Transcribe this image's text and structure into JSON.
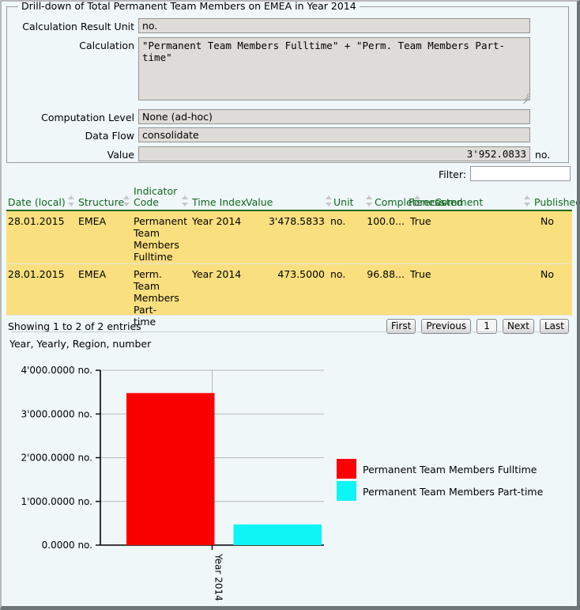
{
  "window": {
    "legend_title": "Drill-down of Total Permanent Team Members on EMEA in Year 2014"
  },
  "form": {
    "fields": [
      {
        "label": "Calculation Result Unit",
        "value": "no."
      },
      {
        "label": "Calculation",
        "value": "\"Permanent Team Members Fulltime\" + \"Perm. Team Members Part-time\""
      },
      {
        "label": "Computation Level",
        "value": "None (ad-hoc)"
      },
      {
        "label": "Data Flow",
        "value": "consolidate"
      },
      {
        "label": "Value",
        "value": "3'952.0833"
      }
    ],
    "value_unit": "no."
  },
  "filter": {
    "label": "Filter:",
    "value": "",
    "placeholder": ""
  },
  "table": {
    "columns": [
      "Date (local)",
      "Structure",
      "Indicator Code",
      "Time Index",
      "Value",
      "Unit",
      "Completeness",
      "Forecasted",
      "Comment",
      "Published"
    ],
    "rows": [
      {
        "date": "28.01.2015",
        "structure": "EMEA",
        "indicator_code": "Permanent Team Members Fulltime",
        "time_index": "Year 2014",
        "value": "3'478.5833",
        "unit": "no.",
        "completeness": "100.0...",
        "forecasted": "True",
        "comment": "",
        "published": "No"
      },
      {
        "date": "28.01.2015",
        "structure": "EMEA",
        "indicator_code": "Perm. Team Members Part-time",
        "time_index": "Year 2014",
        "value": "473.5000",
        "unit": "no.",
        "completeness": "96.88...",
        "forecasted": "True",
        "comment": "",
        "published": "No"
      }
    ],
    "footer": {
      "showing": "Showing 1 to 2 of 2 entries",
      "pager": {
        "first": "First",
        "previous": "Previous",
        "current": "1",
        "next": "Next",
        "last": "Last"
      }
    }
  },
  "chart_data": {
    "type": "bar",
    "title": "Year, Yearly, Region, number",
    "xlabel": "",
    "ylabel": "",
    "categories": [
      "Year 2014"
    ],
    "x_tick_labels": [
      "Year 2014"
    ],
    "y_tick_labels": [
      "0.0000 no.",
      "1'000.0000 no.",
      "2'000.0000 no.",
      "3'000.0000 no.",
      "4'000.0000 no."
    ],
    "y_ticks": [
      0,
      1000,
      2000,
      3000,
      4000
    ],
    "ylim": [
      0,
      4000
    ],
    "grid": true,
    "legend_position": "right",
    "series": [
      {
        "name": "Permanent Team Members Fulltime",
        "color": "#fb0000",
        "values": [
          3478.5833
        ]
      },
      {
        "name": "Permanent Team Members Part-time",
        "color": "#0ef5f5",
        "values": [
          473.5
        ]
      }
    ]
  }
}
